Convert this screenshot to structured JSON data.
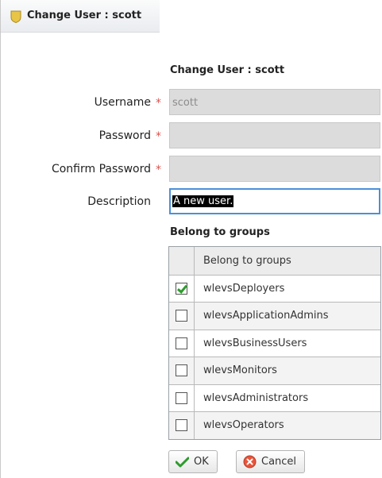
{
  "window": {
    "title": "Change User : scott"
  },
  "form": {
    "heading": "Change User : scott",
    "required_mark": "*",
    "username": {
      "label": "Username",
      "value": "scott"
    },
    "password": {
      "label": "Password",
      "value": ""
    },
    "confirm_password": {
      "label": "Confirm Password",
      "value": ""
    },
    "description": {
      "label": "Description",
      "value": "A new user."
    }
  },
  "groups": {
    "heading": "Belong to groups",
    "column_header": "Belong to groups",
    "rows": [
      {
        "name": "wlevsDeployers",
        "checked": true
      },
      {
        "name": "wlevsApplicationAdmins",
        "checked": false
      },
      {
        "name": "wlevsBusinessUsers",
        "checked": false
      },
      {
        "name": "wlevsMonitors",
        "checked": false
      },
      {
        "name": "wlevsAdministrators",
        "checked": false
      },
      {
        "name": "wlevsOperators",
        "checked": false
      }
    ]
  },
  "buttons": {
    "ok": "OK",
    "cancel": "Cancel"
  },
  "icons": {
    "title": "shield-icon",
    "ok": "checkmark-icon",
    "cancel": "cancel-icon",
    "checkbox_checked": "checkbox-checked-icon",
    "checkbox_unchecked": "checkbox-unchecked-icon"
  },
  "colors": {
    "title_icon": "#e8c547",
    "required": "#d9534f",
    "focus_border": "#4a90d9",
    "check_green": "#2e9b2e",
    "cancel_red": "#e8553b"
  }
}
